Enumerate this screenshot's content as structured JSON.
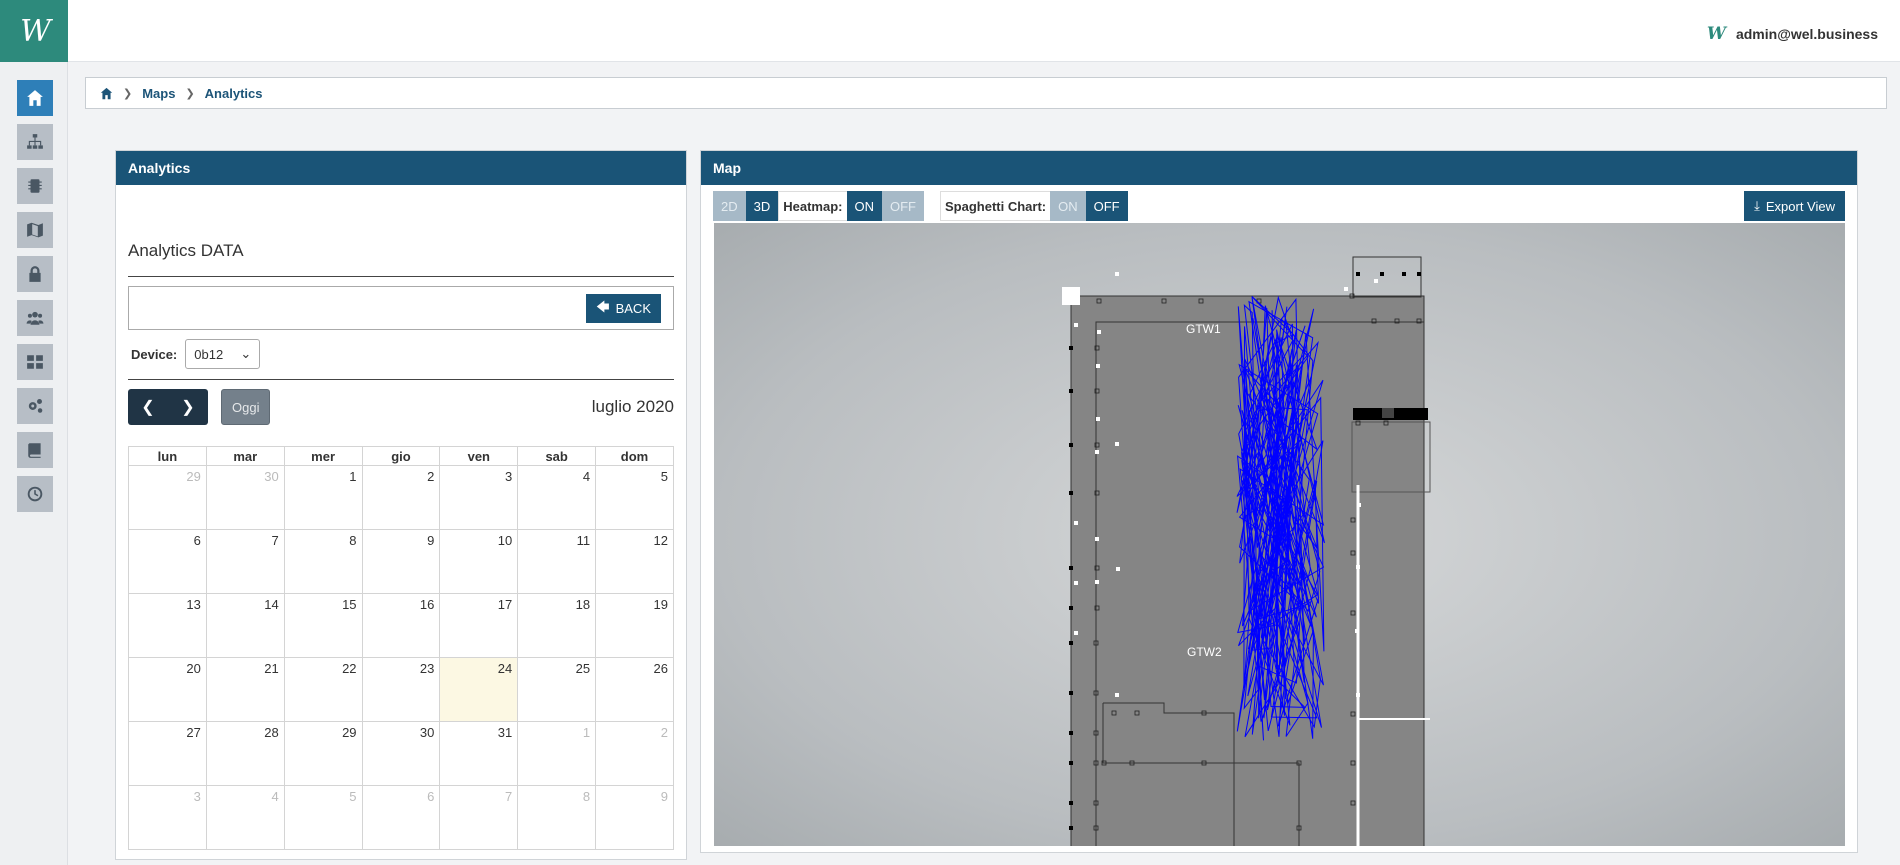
{
  "app": {
    "logo_text": "W",
    "user_logo_text": "W",
    "user_email": "admin@wel.business"
  },
  "breadcrumb": {
    "items": [
      "Maps",
      "Analytics"
    ]
  },
  "sidebar": {
    "items": [
      {
        "name": "home-icon",
        "active": true
      },
      {
        "name": "sitemap-icon",
        "active": false
      },
      {
        "name": "chip-icon",
        "active": false
      },
      {
        "name": "map-icon",
        "active": false
      },
      {
        "name": "lock-icon",
        "active": false
      },
      {
        "name": "users-icon",
        "active": false
      },
      {
        "name": "dashboard-icon",
        "active": false
      },
      {
        "name": "gears-icon",
        "active": false
      },
      {
        "name": "book-icon",
        "active": false
      },
      {
        "name": "clock-icon",
        "active": false
      }
    ]
  },
  "analytics": {
    "header": "Analytics",
    "title": "Analytics DATA",
    "back_label": "BACK",
    "device_label": "Device:",
    "device_value": "0b12",
    "today_label": "Oggi",
    "month_title": "luglio 2020",
    "weekdays": [
      "lun",
      "mar",
      "mer",
      "gio",
      "ven",
      "sab",
      "dom"
    ],
    "weeks": [
      [
        [
          "29",
          true
        ],
        [
          "30",
          true
        ],
        [
          "1",
          false
        ],
        [
          "2",
          false
        ],
        [
          "3",
          false
        ],
        [
          "4",
          false
        ],
        [
          "5",
          false
        ]
      ],
      [
        [
          "6",
          false
        ],
        [
          "7",
          false
        ],
        [
          "8",
          false
        ],
        [
          "9",
          false
        ],
        [
          "10",
          false
        ],
        [
          "11",
          false
        ],
        [
          "12",
          false
        ]
      ],
      [
        [
          "13",
          false
        ],
        [
          "14",
          false
        ],
        [
          "15",
          false
        ],
        [
          "16",
          false
        ],
        [
          "17",
          false
        ],
        [
          "18",
          false
        ],
        [
          "19",
          false
        ]
      ],
      [
        [
          "20",
          false
        ],
        [
          "21",
          false
        ],
        [
          "22",
          false
        ],
        [
          "23",
          false
        ],
        [
          "24",
          false
        ],
        [
          "25",
          false
        ],
        [
          "26",
          false
        ]
      ],
      [
        [
          "27",
          false
        ],
        [
          "28",
          false
        ],
        [
          "29",
          false
        ],
        [
          "30",
          false
        ],
        [
          "31",
          false
        ],
        [
          "1",
          true
        ],
        [
          "2",
          true
        ]
      ],
      [
        [
          "3",
          true
        ],
        [
          "4",
          true
        ],
        [
          "5",
          true
        ],
        [
          "6",
          true
        ],
        [
          "7",
          true
        ],
        [
          "8",
          true
        ],
        [
          "9",
          true
        ]
      ]
    ],
    "today": "24"
  },
  "map": {
    "header": "Map",
    "view_2d": "2D",
    "view_3d": "3D",
    "heatmap_label": "Heatmap:",
    "heatmap_on": "ON",
    "heatmap_off": "OFF",
    "spaghetti_label": "Spaghetti Chart:",
    "spaghetti_on": "ON",
    "spaghetti_off": "OFF",
    "export_label": "Export View",
    "gateways": [
      "GTW1",
      "GTW2"
    ],
    "track_color": "#0000ff"
  }
}
